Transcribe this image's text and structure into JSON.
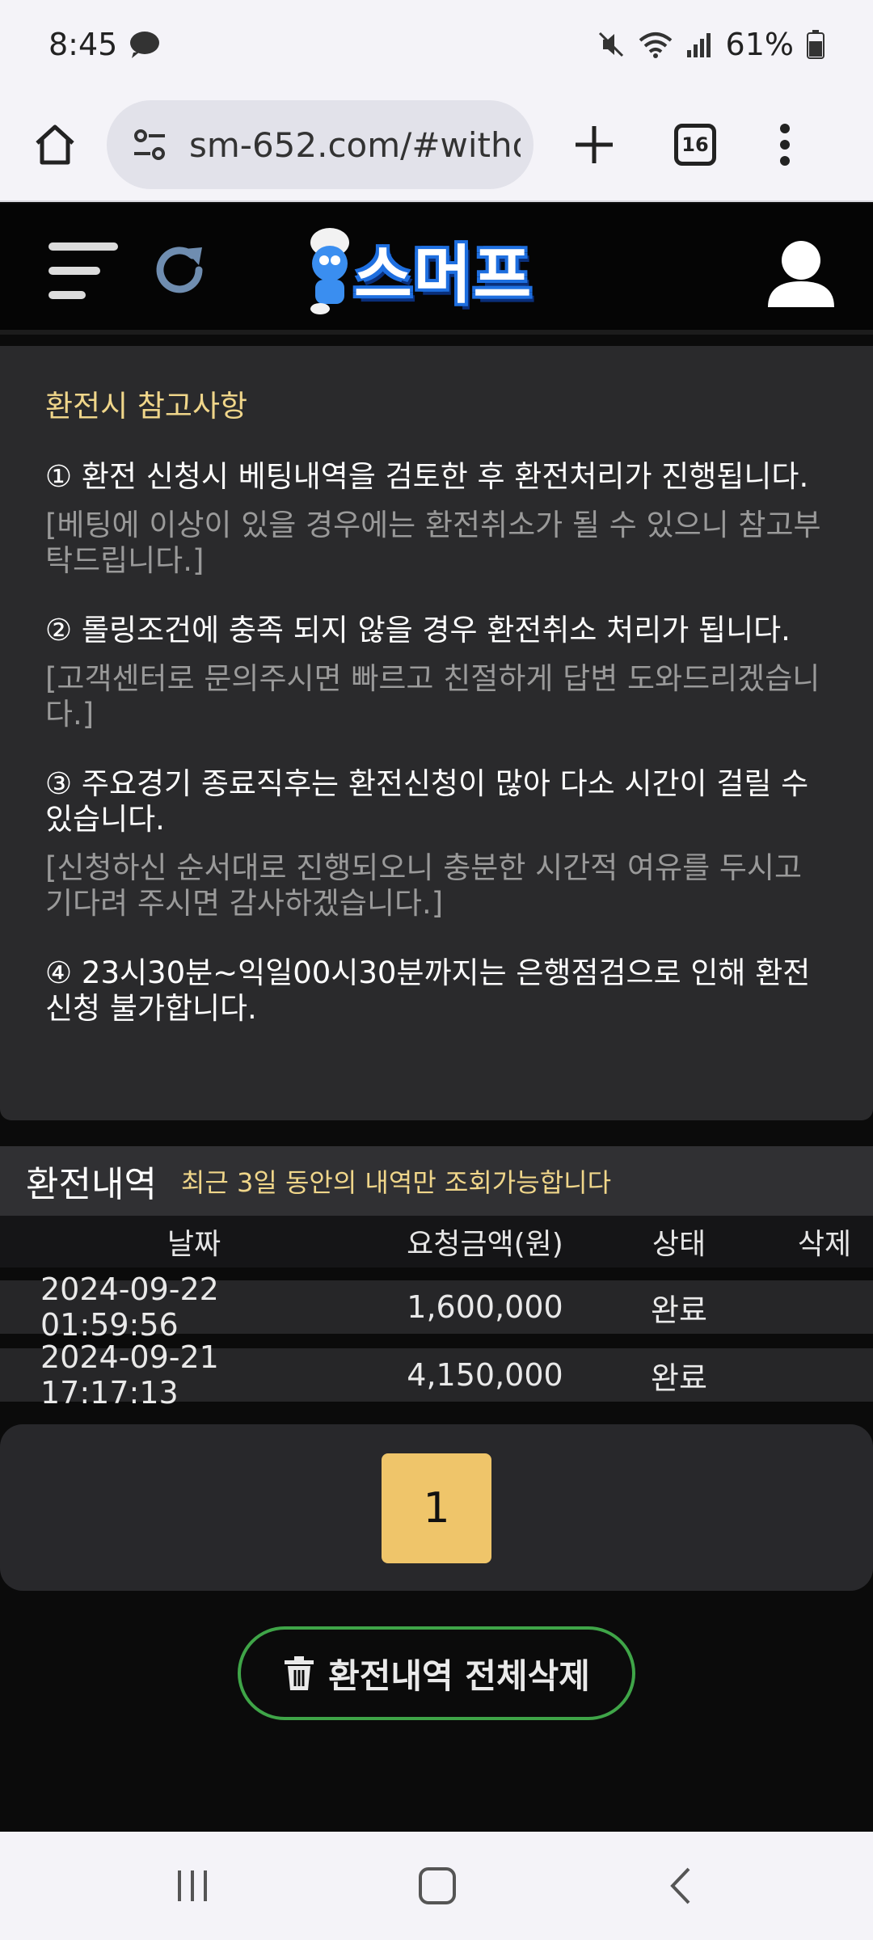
{
  "status_bar": {
    "time": "8:45",
    "battery": "61%",
    "icons": [
      "chat-icon",
      "mute-icon",
      "wifi-icon",
      "signal-icon",
      "battery-icon"
    ]
  },
  "browser": {
    "url": "sm-652.com/#withdr",
    "tab_count": "16"
  },
  "site": {
    "logo_text": "스머프"
  },
  "notice": {
    "title": "환전시 참고사항",
    "items": [
      {
        "text": "① 환전 신청시 베팅내역을 검토한 후 환전처리가 진행됩니다.",
        "sub": "[베팅에 이상이 있을 경우에는 환전취소가 될 수 있으니 참고부탁드립니다.]"
      },
      {
        "text": "② 롤링조건에 충족 되지 않을 경우 환전취소 처리가 됩니다.",
        "sub": "[고객센터로 문의주시면 빠르고 친절하게 답변 도와드리겠습니다.]"
      },
      {
        "text": "③ 주요경기 종료직후는 환전신청이 많아 다소 시간이 걸릴 수 있습니다.",
        "sub": "[신청하신 순서대로 진행되오니 충분한 시간적 여유를 두시고 기다려 주시면 감사하겠습니다.]"
      },
      {
        "text": "④ 23시30분~익일00시30분까지는 은행점검으로 인해 환전신청 불가합니다.",
        "sub": ""
      }
    ]
  },
  "history": {
    "title": "환전내역",
    "subtitle": "최근 3일 동안의 내역만 조회가능합니다",
    "columns": [
      "날짜",
      "요청금액(원)",
      "상태",
      "삭제"
    ],
    "rows": [
      {
        "date": "2024-09-22 01:59:56",
        "amount": "1,600,000",
        "status": "완료"
      },
      {
        "date": "2024-09-21 17:17:13",
        "amount": "4,150,000",
        "status": "완료"
      }
    ]
  },
  "pagination": {
    "current": "1"
  },
  "actions": {
    "delete_all": "환전내역 전체삭제"
  },
  "colors": {
    "accent_yellow": "#f0d68a",
    "page_button": "#efc56a",
    "delete_border": "#3fa548",
    "panel_bg": "#2a2a2c"
  }
}
